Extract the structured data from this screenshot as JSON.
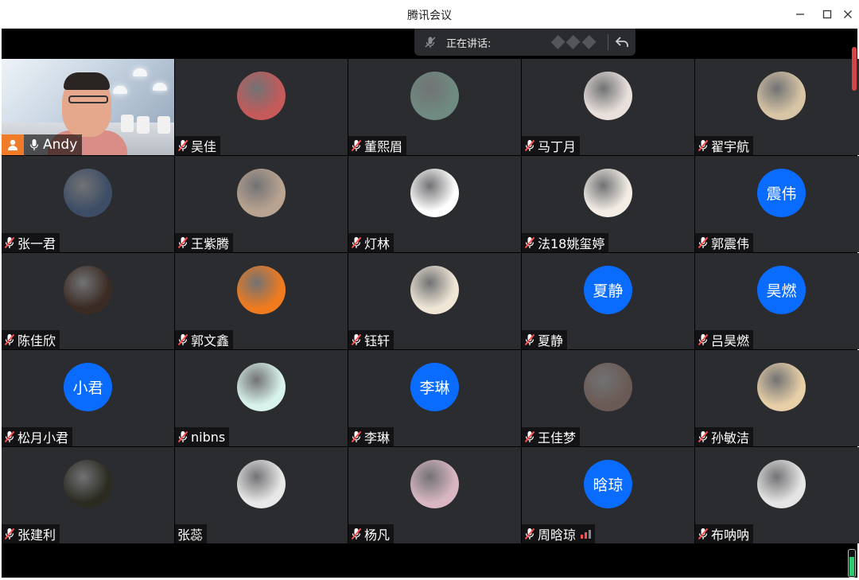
{
  "window": {
    "title": "腾讯会议",
    "minimize_glyph": "—",
    "maximize_glyph": "☐",
    "close_glyph": "✕"
  },
  "speaking": {
    "label": "正在讲话:"
  },
  "colors": {
    "accent": "#0a6cff",
    "host_badge": "#f07c2a",
    "mic_muted": "#ff4d4d",
    "tile_bg": "#2b2c2f"
  },
  "self": {
    "name": "Andy",
    "icon": "host-person-icon"
  },
  "participants": [
    {
      "name": "吴佳",
      "avatar_type": "photo",
      "avatar_color": "#c45a5a",
      "avatar_icon": "photo-avatar"
    },
    {
      "name": "董熙眉",
      "avatar_type": "photo",
      "avatar_color": "#6f8a80",
      "avatar_icon": "photo-avatar"
    },
    {
      "name": "马丁月",
      "avatar_type": "photo",
      "avatar_color": "#e9e0dc",
      "avatar_icon": "photo-avatar"
    },
    {
      "name": "翟宇航",
      "avatar_type": "photo",
      "avatar_color": "#d7c5a5",
      "avatar_icon": "photo-avatar"
    },
    {
      "name": "张一君",
      "avatar_type": "photo",
      "avatar_color": "#3d4d66",
      "avatar_icon": "photo-avatar"
    },
    {
      "name": "王紫腾",
      "avatar_type": "photo",
      "avatar_color": "#b9a391",
      "avatar_icon": "photo-avatar"
    },
    {
      "name": "灯林",
      "avatar_type": "photo",
      "avatar_color": "#ffffff",
      "avatar_icon": "photo-avatar"
    },
    {
      "name": "法18姚玺婷",
      "avatar_type": "photo",
      "avatar_color": "#f3ede6",
      "avatar_icon": "photo-avatar"
    },
    {
      "name": "郭震伟",
      "avatar_type": "text",
      "avatar_text": "震伟"
    },
    {
      "name": "陈佳欣",
      "avatar_type": "photo",
      "avatar_color": "#3a2b24",
      "avatar_icon": "photo-avatar"
    },
    {
      "name": "郭文鑫",
      "avatar_type": "photo",
      "avatar_color": "#f07a1e",
      "avatar_icon": "photo-avatar"
    },
    {
      "name": "钰轩",
      "avatar_type": "photo",
      "avatar_color": "#efe6d6",
      "avatar_icon": "photo-avatar"
    },
    {
      "name": "夏静",
      "avatar_type": "text",
      "avatar_text": "夏静"
    },
    {
      "name": "吕昊燃",
      "avatar_type": "text",
      "avatar_text": "昊燃"
    },
    {
      "name": "松月小君",
      "avatar_type": "text",
      "avatar_text": "小君"
    },
    {
      "name": "nibns",
      "avatar_type": "photo",
      "avatar_color": "#d8f2ec",
      "avatar_icon": "photo-avatar"
    },
    {
      "name": "李琳",
      "avatar_type": "text",
      "avatar_text": "李琳"
    },
    {
      "name": "王佳梦",
      "avatar_type": "photo",
      "avatar_color": "#6a5a55",
      "avatar_icon": "photo-avatar"
    },
    {
      "name": "孙敏洁",
      "avatar_type": "photo",
      "avatar_color": "#e7cfa7",
      "avatar_icon": "photo-avatar"
    },
    {
      "name": "张建利",
      "avatar_type": "photo",
      "avatar_color": "#2b2b22",
      "avatar_icon": "photo-avatar"
    },
    {
      "name": "张蕊",
      "avatar_type": "photo",
      "avatar_color": "#e8e8e8",
      "avatar_icon": "photo-avatar",
      "no_mic_icon": true
    },
    {
      "name": "杨凡",
      "avatar_type": "photo",
      "avatar_color": "#d8b6c2",
      "avatar_icon": "photo-avatar"
    },
    {
      "name": "周晗琼",
      "avatar_type": "text",
      "avatar_text": "晗琼",
      "signal": true
    },
    {
      "name": "布呐呐",
      "avatar_type": "photo",
      "avatar_color": "#e5e5e5",
      "avatar_icon": "photo-avatar"
    }
  ]
}
